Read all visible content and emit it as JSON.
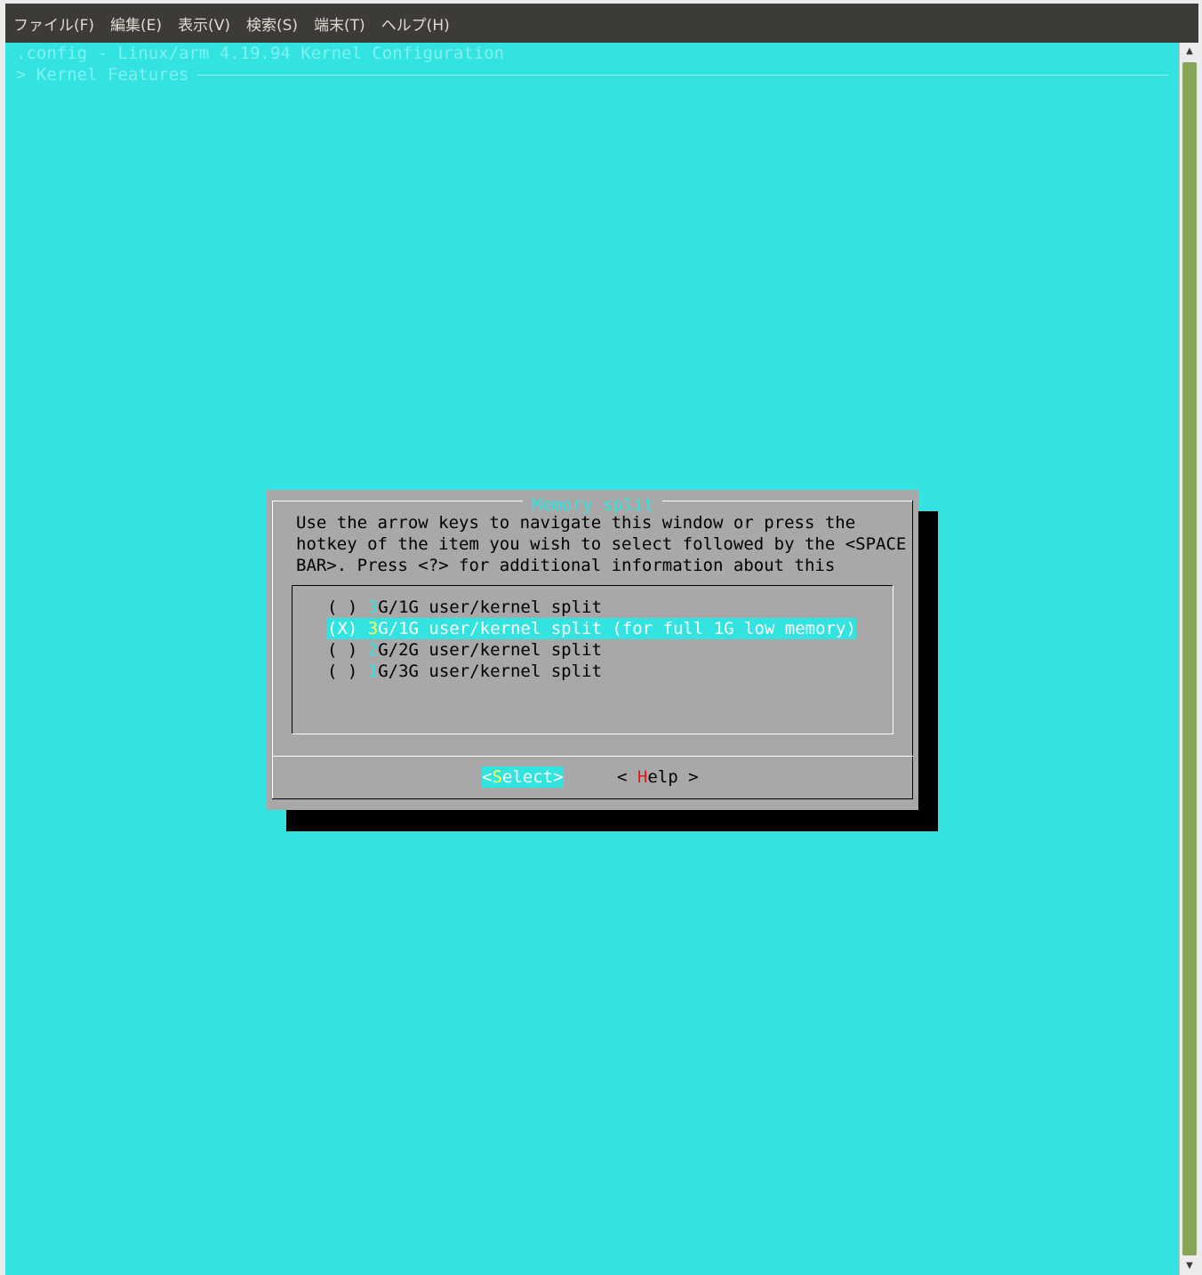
{
  "menubar": {
    "items": [
      "ファイル(F)",
      "編集(E)",
      "表示(V)",
      "検索(S)",
      "端末(T)",
      "ヘルプ(H)"
    ]
  },
  "terminal": {
    "title": ".config - Linux/arm 4.19.94 Kernel Configuration",
    "breadcrumb": "> Kernel Features"
  },
  "dialog": {
    "title": "Memory split",
    "instructions": [
      "Use the arrow keys to navigate this window or press the",
      "hotkey of the item you wish to select followed by the <SPACE",
      "BAR>. Press <?> for additional information about this"
    ],
    "options": [
      {
        "marker": "( )",
        "hotkey": "3",
        "rest": "G/1G user/kernel split",
        "selected": false
      },
      {
        "marker": "(X)",
        "hotkey": "3",
        "rest": "G/1G user/kernel split (for full 1G low memory)",
        "selected": true
      },
      {
        "marker": "( )",
        "hotkey": "2",
        "rest": "G/2G user/kernel split",
        "selected": false
      },
      {
        "marker": "( )",
        "hotkey": "1",
        "rest": "G/3G user/kernel split",
        "selected": false
      }
    ],
    "buttons": {
      "select": {
        "open": "<",
        "hot": "S",
        "rest": "elect>"
      },
      "help": {
        "open": "< ",
        "hot": "H",
        "rest": "elp >"
      }
    }
  },
  "colors": {
    "terminal_bg": "#33e3e0",
    "dialog_bg": "#a8a8a8",
    "menubar_bg": "#3c3b37",
    "hotkey_yellow": "#ffff55",
    "hotkey_red": "#e01b1b",
    "scroll_thumb": "#87a556"
  }
}
